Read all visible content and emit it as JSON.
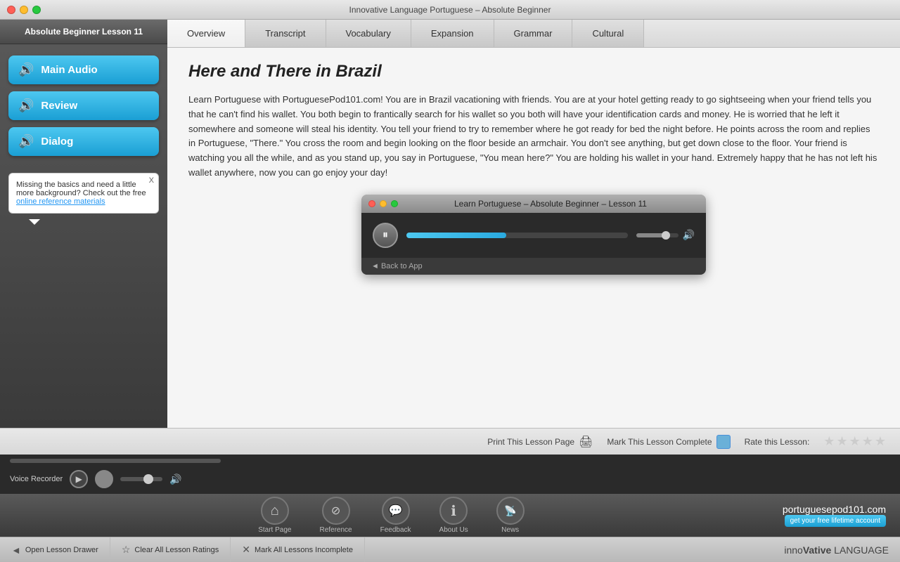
{
  "window": {
    "title": "Innovative Language Portuguese – Absolute Beginner",
    "traffic_lights": [
      "red",
      "yellow",
      "green"
    ]
  },
  "sidebar": {
    "title": "Absolute Beginner Lesson 11",
    "buttons": [
      {
        "label": "Main Audio",
        "icon": "🔊",
        "id": "main-audio"
      },
      {
        "label": "Review",
        "icon": "🔊",
        "id": "review"
      },
      {
        "label": "Dialog",
        "icon": "🔊",
        "id": "dialog"
      }
    ],
    "tooltip": {
      "text": "Missing the basics and need a little more background? Check out the free ",
      "link_text": "online reference materials",
      "close": "X"
    }
  },
  "tabs": [
    {
      "label": "Overview",
      "active": true
    },
    {
      "label": "Transcript",
      "active": false
    },
    {
      "label": "Vocabulary",
      "active": false
    },
    {
      "label": "Expansion",
      "active": false
    },
    {
      "label": "Grammar",
      "active": false
    },
    {
      "label": "Cultural",
      "active": false
    }
  ],
  "lesson": {
    "title": "Here and There in Brazil",
    "body": "Learn Portuguese with PortuguesePod101.com! You are in Brazil vacationing with friends. You are at your hotel getting ready to go sightseeing when your friend tells you that he can't find his wallet. You both begin to frantically search for his wallet so you both will have your identification cards and money. He is worried that he left it somewhere and someone will steal his identity. You tell your friend to try to remember where he got ready for bed the night before. He points across the room and replies in Portuguese, \"There.\" You cross the room and begin looking on the floor beside an armchair. You don't see anything, but get down close to the floor. Your friend is watching you all the while, and as you stand up, you say in Portuguese, \"You mean here?\" You are holding his wallet in your hand. Extremely happy that he has not left his wallet anywhere, now you can go enjoy your day!"
  },
  "audio_player": {
    "title": "Learn Portuguese – Absolute Beginner – Lesson 11",
    "back_btn": "◄ Back to App",
    "progress": 45,
    "volume": 70
  },
  "bottom_toolbar": {
    "print_label": "Print This Lesson Page",
    "complete_label": "Mark This Lesson Complete",
    "rate_label": "Rate this Lesson:",
    "stars": [
      1,
      2,
      3,
      4,
      5
    ]
  },
  "nav": {
    "items": [
      {
        "label": "Start Page",
        "icon": "home"
      },
      {
        "label": "Reference",
        "icon": "reference"
      },
      {
        "label": "Feedback",
        "icon": "feedback"
      },
      {
        "label": "About Us",
        "icon": "info"
      },
      {
        "label": "News",
        "icon": "rss"
      }
    ],
    "brand_url": "portuguesepod101.com",
    "brand_btn": "get your free lifetime account"
  },
  "voice_recorder": {
    "label": "Voice Recorder",
    "volume_indicator": "🔊"
  },
  "action_bar": {
    "buttons": [
      {
        "label": "Open Lesson Drawer",
        "icon": "◄"
      },
      {
        "label": "Clear All Lesson Ratings",
        "icon": "☆"
      },
      {
        "label": "Mark All Lessons Incomplete",
        "icon": "✕"
      }
    ],
    "brand": "inno",
    "brand_bold": "Vative",
    "brand_suffix": " LANGUAGE"
  }
}
